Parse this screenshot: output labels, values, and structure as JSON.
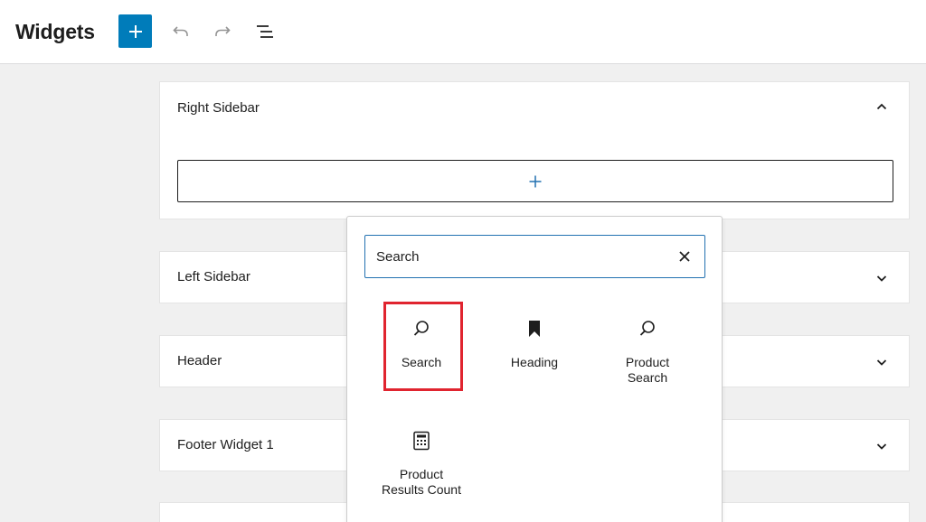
{
  "header": {
    "title": "Widgets",
    "buttons": {
      "add": "plus-icon",
      "undo": "undo-icon",
      "redo": "redo-icon",
      "list_view": "list-view-icon"
    }
  },
  "widget_areas": [
    {
      "title": "Right Sidebar",
      "expanded": true
    },
    {
      "title": "Left Sidebar",
      "expanded": false
    },
    {
      "title": "Header",
      "expanded": false
    },
    {
      "title": "Footer Widget 1",
      "expanded": false
    },
    {
      "title": "",
      "expanded": false
    }
  ],
  "inserter": {
    "search_value": "Search",
    "results": [
      {
        "label": "Search",
        "icon": "search-icon",
        "highlighted": true
      },
      {
        "label": "Heading",
        "icon": "bookmark-icon",
        "highlighted": false
      },
      {
        "label": "Product\nSearch",
        "icon": "search-icon",
        "highlighted": false
      },
      {
        "label": "Product\nResults Count",
        "icon": "calculator-icon",
        "highlighted": false
      }
    ]
  },
  "colors": {
    "accent": "#007cba",
    "focus_border": "#2271b1",
    "highlight": "#e0242f",
    "canvas": "#f0f0f0"
  }
}
